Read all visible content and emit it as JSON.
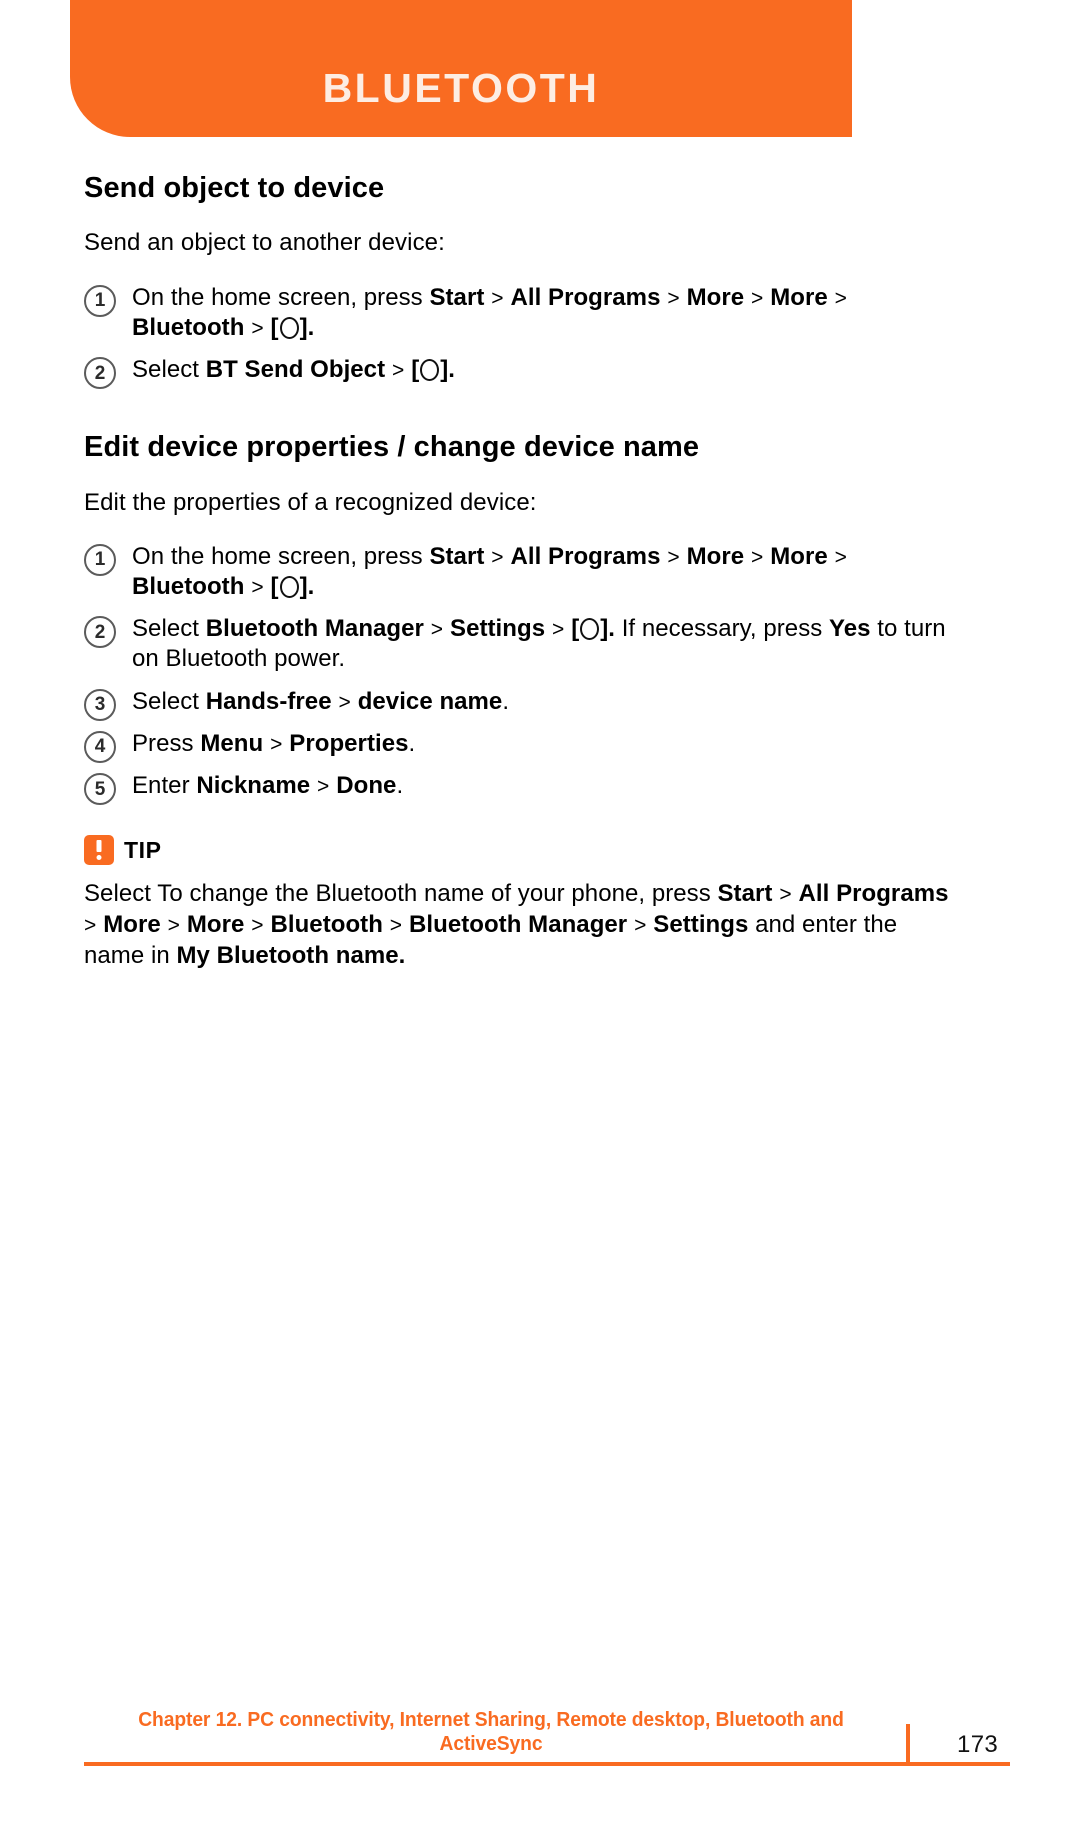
{
  "header": {
    "title": "BLUETOOTH",
    "background_color": "#F96B21",
    "text_color": "#FDEDE3"
  },
  "sections": [
    {
      "heading": "Send object to device",
      "intro": "Send an object to another device:",
      "steps": [
        {
          "number": "1",
          "parts": [
            {
              "type": "text",
              "value": "On the home screen, press "
            },
            {
              "type": "bold",
              "value": "Start"
            },
            {
              "type": "sep",
              "value": " > "
            },
            {
              "type": "bold",
              "value": "All Programs"
            },
            {
              "type": "sep",
              "value": " > "
            },
            {
              "type": "bold",
              "value": "More"
            },
            {
              "type": "sep",
              "value": " > "
            },
            {
              "type": "bold",
              "value": "More"
            },
            {
              "type": "sep",
              "value": " > "
            },
            {
              "type": "bold",
              "value": "Bluetooth"
            },
            {
              "type": "sep",
              "value": " > "
            },
            {
              "type": "okkey",
              "value": "[O]."
            }
          ]
        },
        {
          "number": "2",
          "parts": [
            {
              "type": "text",
              "value": "Select "
            },
            {
              "type": "bold",
              "value": "BT Send Object"
            },
            {
              "type": "sep",
              "value": " > "
            },
            {
              "type": "okkey",
              "value": "[O]."
            }
          ]
        }
      ]
    },
    {
      "heading": "Edit device properties / change device name",
      "intro": "Edit the properties of a recognized device:",
      "steps": [
        {
          "number": "1",
          "parts": [
            {
              "type": "text",
              "value": "On the home screen, press "
            },
            {
              "type": "bold",
              "value": "Start"
            },
            {
              "type": "sep",
              "value": " > "
            },
            {
              "type": "bold",
              "value": "All Programs"
            },
            {
              "type": "sep",
              "value": " > "
            },
            {
              "type": "bold",
              "value": "More"
            },
            {
              "type": "sep",
              "value": " > "
            },
            {
              "type": "bold",
              "value": "More"
            },
            {
              "type": "sep",
              "value": " > "
            },
            {
              "type": "bold",
              "value": "Bluetooth"
            },
            {
              "type": "sep",
              "value": " > "
            },
            {
              "type": "okkey",
              "value": "[O]."
            }
          ]
        },
        {
          "number": "2",
          "parts": [
            {
              "type": "text",
              "value": "Select "
            },
            {
              "type": "bold",
              "value": "Bluetooth Manager"
            },
            {
              "type": "sep",
              "value": " > "
            },
            {
              "type": "bold",
              "value": "Settings"
            },
            {
              "type": "sep",
              "value": " > "
            },
            {
              "type": "okkey",
              "value": "[O]."
            },
            {
              "type": "text",
              "value": " If necessary, press "
            },
            {
              "type": "bold",
              "value": "Yes"
            },
            {
              "type": "text",
              "value": " to turn on Bluetooth power."
            }
          ]
        },
        {
          "number": "3",
          "parts": [
            {
              "type": "text",
              "value": "Select "
            },
            {
              "type": "bold",
              "value": "Hands-free"
            },
            {
              "type": "sep",
              "value": " > "
            },
            {
              "type": "bold",
              "value": "device name"
            },
            {
              "type": "text",
              "value": "."
            }
          ]
        },
        {
          "number": "4",
          "parts": [
            {
              "type": "text",
              "value": "Press "
            },
            {
              "type": "bold",
              "value": "Menu"
            },
            {
              "type": "sep",
              "value": " > "
            },
            {
              "type": "bold",
              "value": "Properties"
            },
            {
              "type": "text",
              "value": "."
            }
          ]
        },
        {
          "number": "5",
          "parts": [
            {
              "type": "text",
              "value": "Enter "
            },
            {
              "type": "bold",
              "value": "Nickname"
            },
            {
              "type": "sep",
              "value": " > "
            },
            {
              "type": "bold",
              "value": "Done"
            },
            {
              "type": "text",
              "value": "."
            }
          ]
        }
      ]
    }
  ],
  "tip": {
    "icon": "exclamation-icon",
    "label": "TIP",
    "icon_color": "#F96B21",
    "parts": [
      {
        "type": "text",
        "value": "Select To change the Bluetooth name of your phone, press "
      },
      {
        "type": "bold",
        "value": "Start"
      },
      {
        "type": "sep",
        "value": " > "
      },
      {
        "type": "bold",
        "value": "All Programs"
      },
      {
        "type": "sep",
        "value": " > "
      },
      {
        "type": "bold",
        "value": "More"
      },
      {
        "type": "sep",
        "value": " > "
      },
      {
        "type": "bold",
        "value": "More"
      },
      {
        "type": "sep",
        "value": " > "
      },
      {
        "type": "bold",
        "value": "Bluetooth"
      },
      {
        "type": "sep",
        "value": " > "
      },
      {
        "type": "bold",
        "value": "Bluetooth Manager"
      },
      {
        "type": "sep",
        "value": " > "
      },
      {
        "type": "bold",
        "value": "Settings"
      },
      {
        "type": "text",
        "value": " and enter the name in "
      },
      {
        "type": "bold",
        "value": "My Bluetooth name."
      }
    ]
  },
  "footer": {
    "chapter_text": "Chapter 12. PC connectivity, Internet Sharing, Remote desktop, Bluetooth and ActiveSync",
    "page_number": "173",
    "accent_color": "#F96B21"
  }
}
